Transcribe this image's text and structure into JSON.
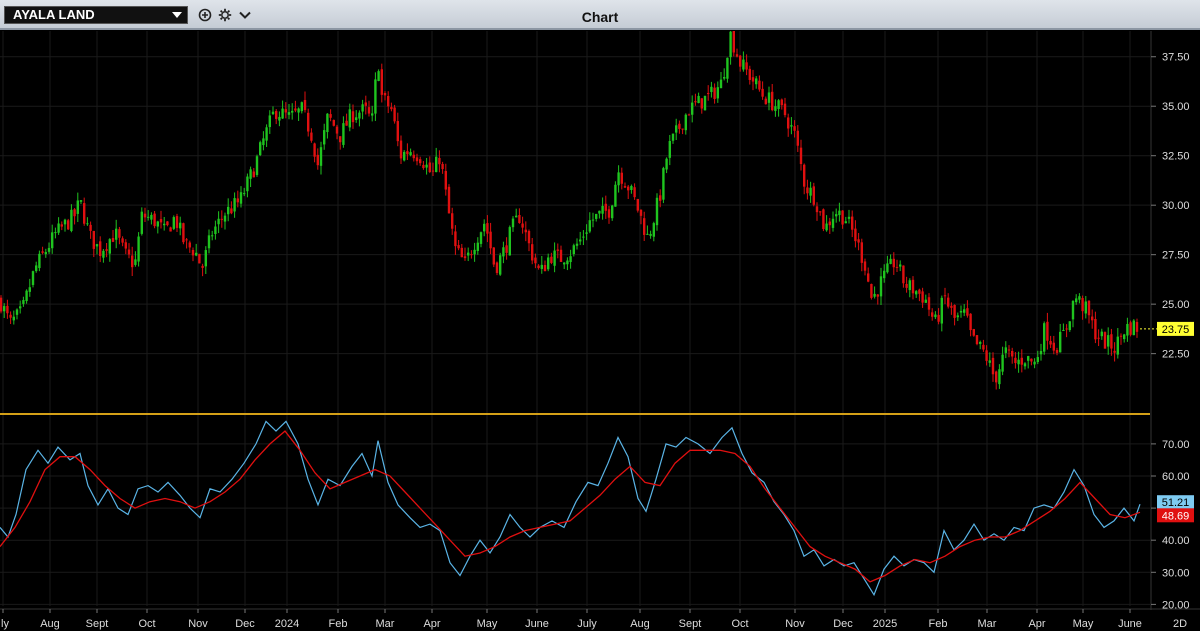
{
  "header": {
    "symbol": "AYALA LAND",
    "title": "Chart"
  },
  "colors": {
    "up": "#1fc41f",
    "down": "#e01010",
    "rsi": "#5ab4e6",
    "rsi_signal": "#e01010",
    "separator": "#d4a017",
    "last_price_tag": "#ffff33",
    "grid": "#1a1a1a"
  },
  "chart_data": [
    {
      "type": "candlestick",
      "title": "",
      "y_ticks": [
        22.5,
        25,
        27.5,
        30,
        32.5,
        35,
        37.5
      ],
      "ylim": [
        19.4,
        38.8
      ],
      "last_price": "23.75",
      "x_tick_labels": [
        "July",
        "Aug",
        "Sept",
        "Oct",
        "Nov",
        "Dec",
        "2024",
        "Feb",
        "Mar",
        "Apr",
        "May",
        "June",
        "July",
        "Aug",
        "Sept",
        "Oct",
        "Nov",
        "Dec",
        "2025",
        "Feb",
        "Mar",
        "Apr",
        "May",
        "June"
      ],
      "period_label": "2D",
      "close_path": [
        [
          0,
          25.2
        ],
        [
          10,
          24
        ],
        [
          22,
          24.6
        ],
        [
          35,
          26.8
        ],
        [
          55,
          28.5
        ],
        [
          75,
          29.5
        ],
        [
          80,
          30.2
        ],
        [
          90,
          28.4
        ],
        [
          100,
          27.7
        ],
        [
          115,
          28.6
        ],
        [
          125,
          27.5
        ],
        [
          135,
          27
        ],
        [
          142,
          29.5
        ],
        [
          155,
          29.2
        ],
        [
          165,
          28.6
        ],
        [
          175,
          29.4
        ],
        [
          185,
          28
        ],
        [
          195,
          27.7
        ],
        [
          202,
          26.8
        ],
        [
          212,
          28.6
        ],
        [
          225,
          29.6
        ],
        [
          240,
          30.2
        ],
        [
          255,
          32
        ],
        [
          265,
          33.5
        ],
        [
          275,
          34.8
        ],
        [
          290,
          34.4
        ],
        [
          302,
          34.8
        ],
        [
          312,
          33.5
        ],
        [
          318,
          32
        ],
        [
          328,
          34.5
        ],
        [
          340,
          33.5
        ],
        [
          352,
          34.6
        ],
        [
          365,
          34.8
        ],
        [
          372,
          34.2
        ],
        [
          378,
          37.5
        ],
        [
          382,
          35.4
        ],
        [
          392,
          34.8
        ],
        [
          400,
          32.5
        ],
        [
          410,
          32.8
        ],
        [
          420,
          32.5
        ],
        [
          432,
          31.5
        ],
        [
          440,
          32.5
        ],
        [
          448,
          29.8
        ],
        [
          455,
          27.8
        ],
        [
          465,
          27
        ],
        [
          475,
          28.2
        ],
        [
          485,
          29.2
        ],
        [
          495,
          26.8
        ],
        [
          505,
          27.8
        ],
        [
          512,
          28.8
        ],
        [
          520,
          29.5
        ],
        [
          530,
          27.8
        ],
        [
          540,
          26.5
        ],
        [
          550,
          27.5
        ],
        [
          560,
          27.3
        ],
        [
          572,
          27.7
        ],
        [
          580,
          28.2
        ],
        [
          590,
          29.2
        ],
        [
          600,
          29.5
        ],
        [
          610,
          29.8
        ],
        [
          618,
          31.8
        ],
        [
          630,
          30.8
        ],
        [
          638,
          29.8
        ],
        [
          648,
          28.3
        ],
        [
          660,
          30.5
        ],
        [
          668,
          32.8
        ],
        [
          678,
          33.8
        ],
        [
          688,
          34.8
        ],
        [
          700,
          35.2
        ],
        [
          712,
          35.6
        ],
        [
          722,
          36.2
        ],
        [
          730,
          38.7
        ],
        [
          740,
          37.2
        ],
        [
          752,
          36.4
        ],
        [
          762,
          35.6
        ],
        [
          772,
          35.2
        ],
        [
          785,
          34.6
        ],
        [
          795,
          33.5
        ],
        [
          805,
          31
        ],
        [
          815,
          30.4
        ],
        [
          825,
          28.8
        ],
        [
          835,
          29.7
        ],
        [
          845,
          29.4
        ],
        [
          855,
          28.4
        ],
        [
          865,
          27
        ],
        [
          872,
          25.2
        ],
        [
          882,
          26.2
        ],
        [
          895,
          27.2
        ],
        [
          905,
          26
        ],
        [
          915,
          25.7
        ],
        [
          925,
          25.3
        ],
        [
          935,
          24
        ],
        [
          945,
          25.3
        ],
        [
          955,
          24.2
        ],
        [
          965,
          24.5
        ],
        [
          972,
          23.2
        ],
        [
          985,
          22.5
        ],
        [
          995,
          21.2
        ],
        [
          1005,
          22.6
        ],
        [
          1015,
          22
        ],
        [
          1025,
          22.3
        ],
        [
          1035,
          22
        ],
        [
          1045,
          23.8
        ],
        [
          1055,
          22.8
        ],
        [
          1065,
          23.6
        ],
        [
          1075,
          25.4
        ],
        [
          1085,
          24.8
        ],
        [
          1095,
          23.6
        ],
        [
          1105,
          23.1
        ],
        [
          1115,
          22.8
        ],
        [
          1125,
          23.8
        ],
        [
          1135,
          23.9
        ],
        [
          1140,
          23.75
        ]
      ]
    },
    {
      "type": "line",
      "title": "",
      "y_ticks": [
        20,
        30,
        40,
        50,
        60,
        70
      ],
      "ylim": [
        19.5,
        79
      ],
      "series": [
        {
          "role": "rsi",
          "last_value": "51.21",
          "points": [
            [
              0,
              44
            ],
            [
              8,
              41
            ],
            [
              16,
              48
            ],
            [
              26,
              62
            ],
            [
              38,
              68
            ],
            [
              48,
              64
            ],
            [
              58,
              69
            ],
            [
              70,
              65
            ],
            [
              80,
              67
            ],
            [
              88,
              57
            ],
            [
              98,
              51
            ],
            [
              108,
              56
            ],
            [
              118,
              50
            ],
            [
              128,
              48
            ],
            [
              138,
              56
            ],
            [
              148,
              57
            ],
            [
              158,
              55
            ],
            [
              168,
              58
            ],
            [
              180,
              54
            ],
            [
              190,
              50
            ],
            [
              200,
              47
            ],
            [
              210,
              56
            ],
            [
              220,
              55
            ],
            [
              232,
              59
            ],
            [
              244,
              64
            ],
            [
              256,
              70
            ],
            [
              266,
              77
            ],
            [
              276,
              74
            ],
            [
              286,
              77
            ],
            [
              298,
              70
            ],
            [
              308,
              59
            ],
            [
              318,
              51
            ],
            [
              328,
              59
            ],
            [
              340,
              57
            ],
            [
              352,
              63
            ],
            [
              362,
              67
            ],
            [
              372,
              60
            ],
            [
              378,
              71
            ],
            [
              388,
              58
            ],
            [
              398,
              51
            ],
            [
              410,
              47
            ],
            [
              420,
              44
            ],
            [
              430,
              45
            ],
            [
              440,
              43
            ],
            [
              450,
              33
            ],
            [
              460,
              29
            ],
            [
              470,
              35
            ],
            [
              480,
              40
            ],
            [
              490,
              36
            ],
            [
              500,
              41
            ],
            [
              510,
              48
            ],
            [
              520,
              44
            ],
            [
              530,
              41
            ],
            [
              540,
              44
            ],
            [
              552,
              46
            ],
            [
              564,
              44
            ],
            [
              576,
              52
            ],
            [
              588,
              58
            ],
            [
              598,
              57
            ],
            [
              608,
              64
            ],
            [
              618,
              72
            ],
            [
              628,
              66
            ],
            [
              638,
              53
            ],
            [
              646,
              49
            ],
            [
              656,
              59
            ],
            [
              666,
              70
            ],
            [
              676,
              69
            ],
            [
              686,
              72
            ],
            [
              698,
              70
            ],
            [
              710,
              67
            ],
            [
              722,
              72
            ],
            [
              732,
              75
            ],
            [
              742,
              67
            ],
            [
              752,
              61
            ],
            [
              764,
              58
            ],
            [
              774,
              52
            ],
            [
              784,
              48
            ],
            [
              794,
              43
            ],
            [
              804,
              35
            ],
            [
              814,
              37
            ],
            [
              824,
              32
            ],
            [
              834,
              34
            ],
            [
              844,
              32
            ],
            [
              854,
              33
            ],
            [
              864,
              28
            ],
            [
              874,
              23
            ],
            [
              884,
              31
            ],
            [
              894,
              35
            ],
            [
              904,
              32
            ],
            [
              914,
              34
            ],
            [
              924,
              33
            ],
            [
              934,
              30
            ],
            [
              944,
              43
            ],
            [
              954,
              37
            ],
            [
              964,
              40
            ],
            [
              974,
              45
            ],
            [
              984,
              40
            ],
            [
              994,
              42
            ],
            [
              1004,
              40
            ],
            [
              1014,
              44
            ],
            [
              1024,
              43
            ],
            [
              1034,
              50
            ],
            [
              1044,
              51
            ],
            [
              1054,
              50
            ],
            [
              1064,
              55
            ],
            [
              1074,
              62
            ],
            [
              1084,
              57
            ],
            [
              1094,
              48
            ],
            [
              1104,
              44
            ],
            [
              1114,
              46
            ],
            [
              1124,
              50
            ],
            [
              1134,
              46
            ],
            [
              1140,
              51.2
            ]
          ]
        },
        {
          "role": "signal",
          "last_value": "48.69",
          "points": [
            [
              0,
              38
            ],
            [
              15,
              44
            ],
            [
              30,
              52
            ],
            [
              45,
              62
            ],
            [
              60,
              66
            ],
            [
              75,
              66
            ],
            [
              90,
              62
            ],
            [
              105,
              57
            ],
            [
              120,
              53
            ],
            [
              135,
              50
            ],
            [
              150,
              52
            ],
            [
              165,
              53
            ],
            [
              180,
              52
            ],
            [
              195,
              50
            ],
            [
              210,
              52
            ],
            [
              225,
              55
            ],
            [
              240,
              59
            ],
            [
              255,
              65
            ],
            [
              270,
              70
            ],
            [
              285,
              74
            ],
            [
              300,
              68
            ],
            [
              315,
              61
            ],
            [
              330,
              56
            ],
            [
              345,
              58
            ],
            [
              360,
              60
            ],
            [
              375,
              62
            ],
            [
              390,
              60
            ],
            [
              405,
              55
            ],
            [
              420,
              50
            ],
            [
              435,
              45
            ],
            [
              450,
              40
            ],
            [
              465,
              35
            ],
            [
              480,
              36
            ],
            [
              495,
              38
            ],
            [
              510,
              41
            ],
            [
              525,
              43
            ],
            [
              540,
              44
            ],
            [
              555,
              45
            ],
            [
              570,
              46
            ],
            [
              585,
              50
            ],
            [
              600,
              54
            ],
            [
              615,
              59
            ],
            [
              630,
              63
            ],
            [
              645,
              58
            ],
            [
              660,
              57
            ],
            [
              675,
              64
            ],
            [
              690,
              68
            ],
            [
              705,
              68
            ],
            [
              720,
              68
            ],
            [
              735,
              67
            ],
            [
              750,
              63
            ],
            [
              765,
              56
            ],
            [
              780,
              50
            ],
            [
              795,
              44
            ],
            [
              810,
              38
            ],
            [
              825,
              35
            ],
            [
              840,
              33
            ],
            [
              855,
              31
            ],
            [
              870,
              27
            ],
            [
              885,
              29
            ],
            [
              900,
              32
            ],
            [
              915,
              34
            ],
            [
              930,
              33
            ],
            [
              945,
              35
            ],
            [
              960,
              38
            ],
            [
              975,
              40
            ],
            [
              990,
              41
            ],
            [
              1005,
              41
            ],
            [
              1020,
              43
            ],
            [
              1035,
              46
            ],
            [
              1050,
              49
            ],
            [
              1065,
              53
            ],
            [
              1080,
              58
            ],
            [
              1095,
              53
            ],
            [
              1110,
              48
            ],
            [
              1125,
              47
            ],
            [
              1140,
              48.7
            ]
          ]
        }
      ]
    }
  ]
}
